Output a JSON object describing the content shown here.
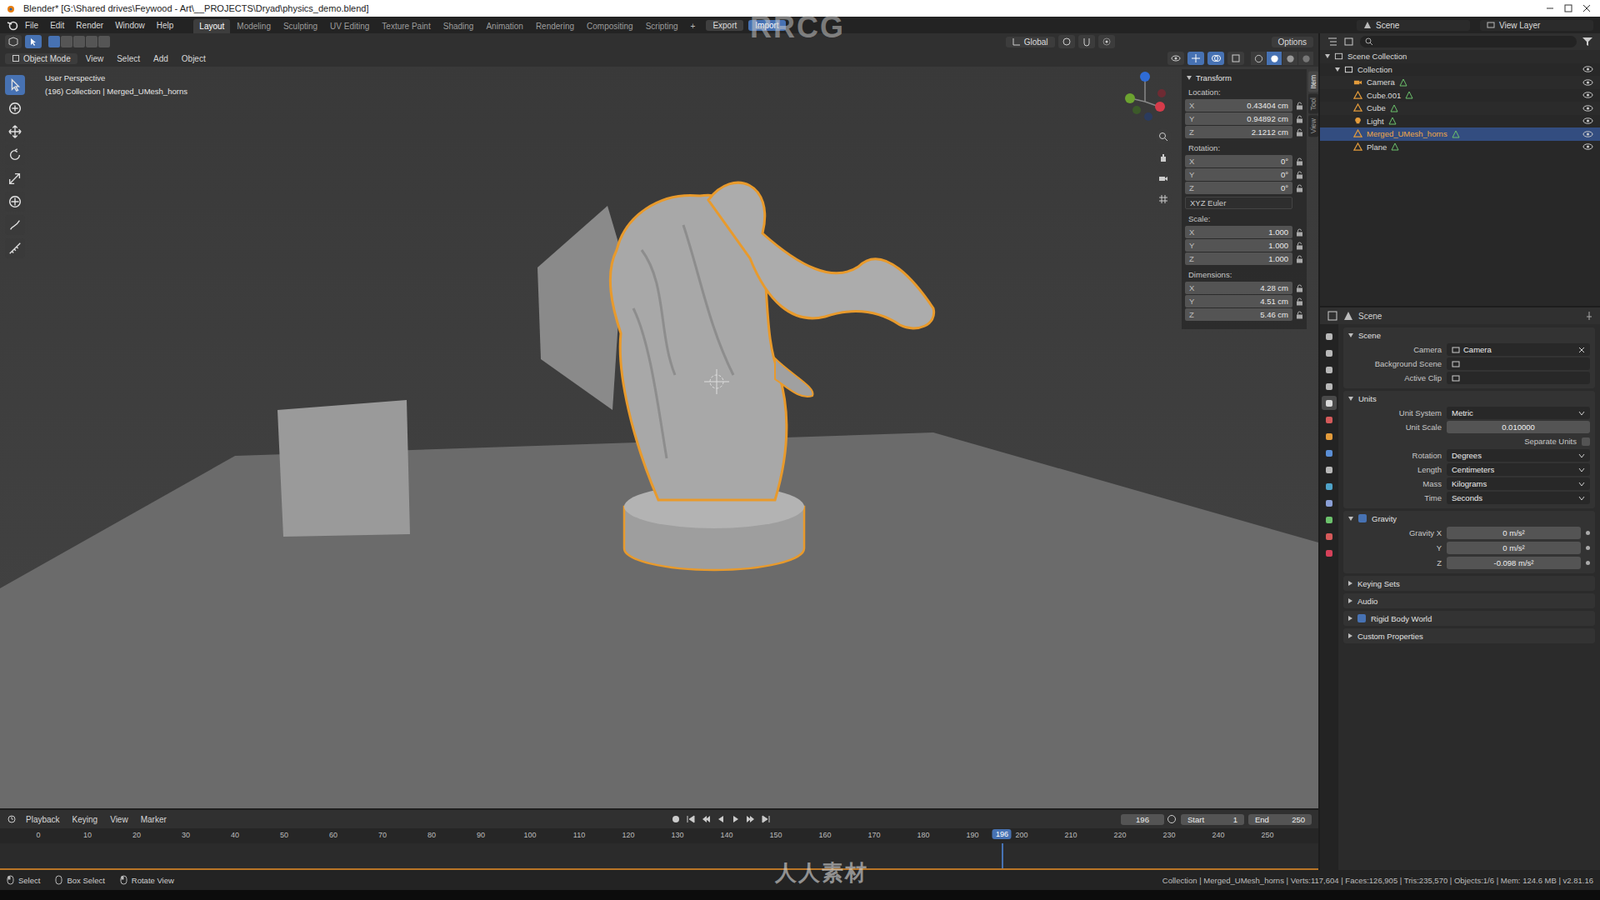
{
  "window": {
    "title": "Blender* [G:\\Shared drives\\Feywood - Art\\__PROJECTS\\Dryad\\physics_demo.blend]"
  },
  "menus": [
    "File",
    "Edit",
    "Render",
    "Window",
    "Help"
  ],
  "workspaces": [
    {
      "label": "Layout",
      "selected": true
    },
    {
      "label": "Modeling",
      "selected": false
    },
    {
      "label": "Sculpting",
      "selected": false
    },
    {
      "label": "UV Editing",
      "selected": false
    },
    {
      "label": "Texture Paint",
      "selected": false
    },
    {
      "label": "Shading",
      "selected": false
    },
    {
      "label": "Animation",
      "selected": false
    },
    {
      "label": "Rendering",
      "selected": false
    },
    {
      "label": "Compositing",
      "selected": false
    },
    {
      "label": "Scripting",
      "selected": false
    }
  ],
  "add_workspace": "+",
  "actions": [
    {
      "label": "Export",
      "active": false
    },
    {
      "label": "Import",
      "active": true
    }
  ],
  "scene": "Scene",
  "view_layer": "View Layer",
  "viewport": {
    "orientation": "Global",
    "options": "Options",
    "mode": "Object Mode",
    "menus": [
      "View",
      "Select",
      "Add",
      "Object"
    ],
    "view_name": "User Perspective",
    "info": "(196) Collection | Merged_UMesh_horns"
  },
  "tools": [
    {
      "selected": true
    },
    {
      "selected": false
    },
    {
      "selected": false
    },
    {
      "selected": false
    },
    {
      "selected": false
    },
    {
      "selected": false
    },
    {
      "selected": false
    },
    {
      "selected": false
    }
  ],
  "sidebar_tabs": [
    {
      "label": "Item",
      "selected": true
    },
    {
      "label": "Tool",
      "selected": false
    },
    {
      "label": "View",
      "selected": false
    }
  ],
  "transform": {
    "title": "Transform",
    "groups": [
      {
        "label": "Location:",
        "fields": [
          {
            "axis": "X",
            "value": "0.43404 cm"
          },
          {
            "axis": "Y",
            "value": "0.94892 cm"
          },
          {
            "axis": "Z",
            "value": "2.1212 cm"
          }
        ]
      },
      {
        "label": "Rotation:",
        "fields": [
          {
            "axis": "X",
            "value": "0°"
          },
          {
            "axis": "Y",
            "value": "0°"
          },
          {
            "axis": "Z",
            "value": "0°"
          }
        ],
        "footer": "XYZ Euler"
      },
      {
        "label": "Scale:",
        "fields": [
          {
            "axis": "X",
            "value": "1.000"
          },
          {
            "axis": "Y",
            "value": "1.000"
          },
          {
            "axis": "Z",
            "value": "1.000"
          }
        ]
      },
      {
        "label": "Dimensions:",
        "fields": [
          {
            "axis": "X",
            "value": "4.28 cm"
          },
          {
            "axis": "Y",
            "value": "4.51 cm"
          },
          {
            "axis": "Z",
            "value": "5.46 cm"
          }
        ]
      }
    ]
  },
  "outliner": {
    "items": [
      {
        "name": "Scene Collection",
        "depth": 0,
        "kind": "scene",
        "expanded": true,
        "selected": false
      },
      {
        "name": "Collection",
        "depth": 1,
        "kind": "collection",
        "expanded": true,
        "selected": false
      },
      {
        "name": "Camera",
        "depth": 2,
        "kind": "camera",
        "selected": false
      },
      {
        "name": "Cube.001",
        "depth": 2,
        "kind": "mesh",
        "selected": false
      },
      {
        "name": "Cube",
        "depth": 2,
        "kind": "mesh",
        "selected": false
      },
      {
        "name": "Light",
        "depth": 2,
        "kind": "light",
        "selected": false
      },
      {
        "name": "Merged_UMesh_horns",
        "depth": 2,
        "kind": "mesh",
        "selected": true
      },
      {
        "name": "Plane",
        "depth": 2,
        "kind": "mesh",
        "selected": false
      }
    ]
  },
  "property_tabs": [
    {
      "selected": false
    },
    {
      "selected": false
    },
    {
      "selected": false
    },
    {
      "selected": false
    },
    {
      "selected": true
    },
    {
      "selected": false
    },
    {
      "selected": false
    },
    {
      "selected": false
    },
    {
      "selected": false
    },
    {
      "selected": false
    },
    {
      "selected": false
    },
    {
      "selected": false
    },
    {
      "selected": false
    },
    {
      "selected": false
    }
  ],
  "properties": {
    "context": "Scene",
    "scene_panel": {
      "title": "Scene",
      "expanded": true,
      "rows": [
        {
          "label": "Camera",
          "value": "Camera",
          "kind": "picker"
        },
        {
          "label": "Background Scene",
          "kind": "empty"
        },
        {
          "label": "Active Clip",
          "kind": "empty"
        }
      ]
    },
    "units_panel": {
      "title": "Units",
      "expanded": true,
      "rows": [
        {
          "label": "Unit System",
          "value": "Metric",
          "kind": "dropdown"
        },
        {
          "label": "Unit Scale",
          "value": "0.010000",
          "kind": "number"
        },
        {
          "label": "Separate Units",
          "kind": "checkbox",
          "checked": false
        },
        {
          "label": "Rotation",
          "value": "Degrees",
          "kind": "dropdown"
        },
        {
          "label": "Length",
          "value": "Centimeters",
          "kind": "dropdown"
        },
        {
          "label": "Mass",
          "value": "Kilograms",
          "kind": "dropdown"
        },
        {
          "label": "Time",
          "value": "Seconds",
          "kind": "dropdown"
        }
      ]
    },
    "gravity_panel": {
      "title": "Gravity",
      "checked": true,
      "expanded": true,
      "rows": [
        {
          "label": "Gravity X",
          "value": "0 m/s²"
        },
        {
          "label": "Y",
          "value": "0 m/s²"
        },
        {
          "label": "Z",
          "value": "-0.098 m/s²"
        }
      ]
    },
    "collapsed_panels": [
      {
        "title": "Keying Sets",
        "kind": "plain",
        "checked": false
      },
      {
        "title": "Audio",
        "kind": "plain",
        "checked": false
      },
      {
        "title": "Rigid Body World",
        "kind": "checkbox",
        "checked": true
      },
      {
        "title": "Custom Properties",
        "kind": "plain",
        "checked": false
      }
    ]
  },
  "timeline": {
    "menus": [
      "Playback",
      "Keying",
      "View",
      "Marker"
    ],
    "current": "196",
    "start_label": "Start",
    "start": "1",
    "end_label": "End",
    "end": "250",
    "ticks": [
      "0",
      "10",
      "20",
      "30",
      "40",
      "50",
      "60",
      "70",
      "80",
      "90",
      "100",
      "110",
      "120",
      "130",
      "140",
      "150",
      "160",
      "170",
      "180",
      "190",
      "200",
      "210",
      "220",
      "230",
      "240",
      "250"
    ]
  },
  "status": {
    "hints": [
      "Select",
      "Box Select",
      "Rotate View"
    ],
    "info": "Collection | Merged_UMesh_horns | Verts:117,604 | Faces:126,905 | Tris:235,570 | Objects:1/6 | Mem: 124.6 MB | v2.81.16"
  },
  "watermark": {
    "top": "RRCG",
    "bottom": "人人素材"
  }
}
